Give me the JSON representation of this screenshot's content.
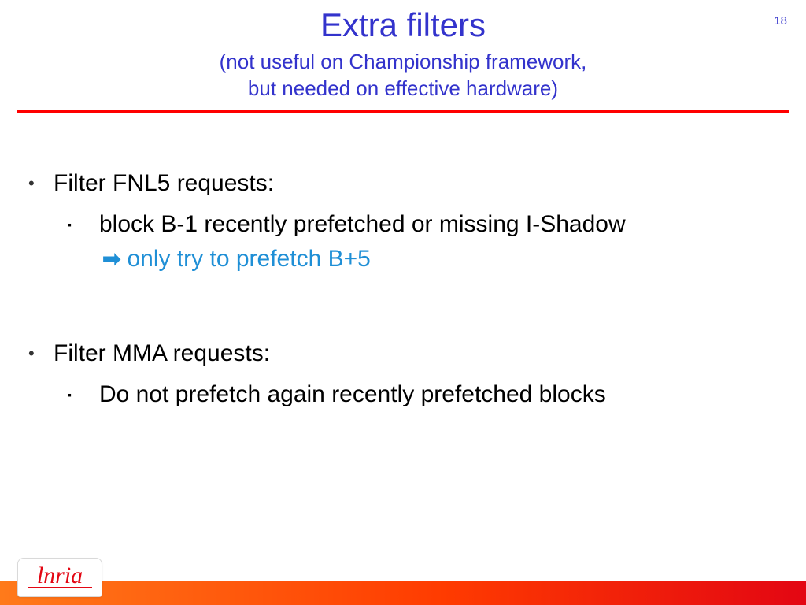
{
  "pageNumber": "18",
  "title": "Extra filters",
  "subtitleLine1": "(not useful on Championship framework,",
  "subtitleLine2": "but needed on effective hardware)",
  "bullets": {
    "b1": "Filter FNL5 requests:",
    "b1a": "block B-1 recently prefetched or missing I-Shadow",
    "b1arrow": "only try to prefetch B+5",
    "b2": "Filter MMA requests:",
    "b2a": "Do not prefetch again recently prefetched blocks"
  },
  "logo": "lnria"
}
